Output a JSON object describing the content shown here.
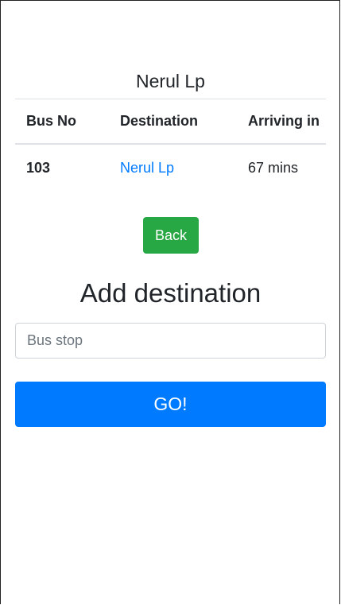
{
  "stop": {
    "name": "Nerul Lp"
  },
  "table": {
    "headers": {
      "bus_no": "Bus No",
      "destination": "Destination",
      "arriving_in": "Arriving in"
    },
    "rows": [
      {
        "bus_no": "103",
        "destination": "Nerul Lp",
        "arriving_in": "67 mins"
      }
    ]
  },
  "buttons": {
    "back_label": "Back",
    "go_label": "GO!"
  },
  "add_destination": {
    "title": "Add destination",
    "placeholder": "Bus stop",
    "value": ""
  },
  "colors": {
    "link": "#007bff",
    "back_button": "#28a745",
    "go_button": "#007bff"
  }
}
